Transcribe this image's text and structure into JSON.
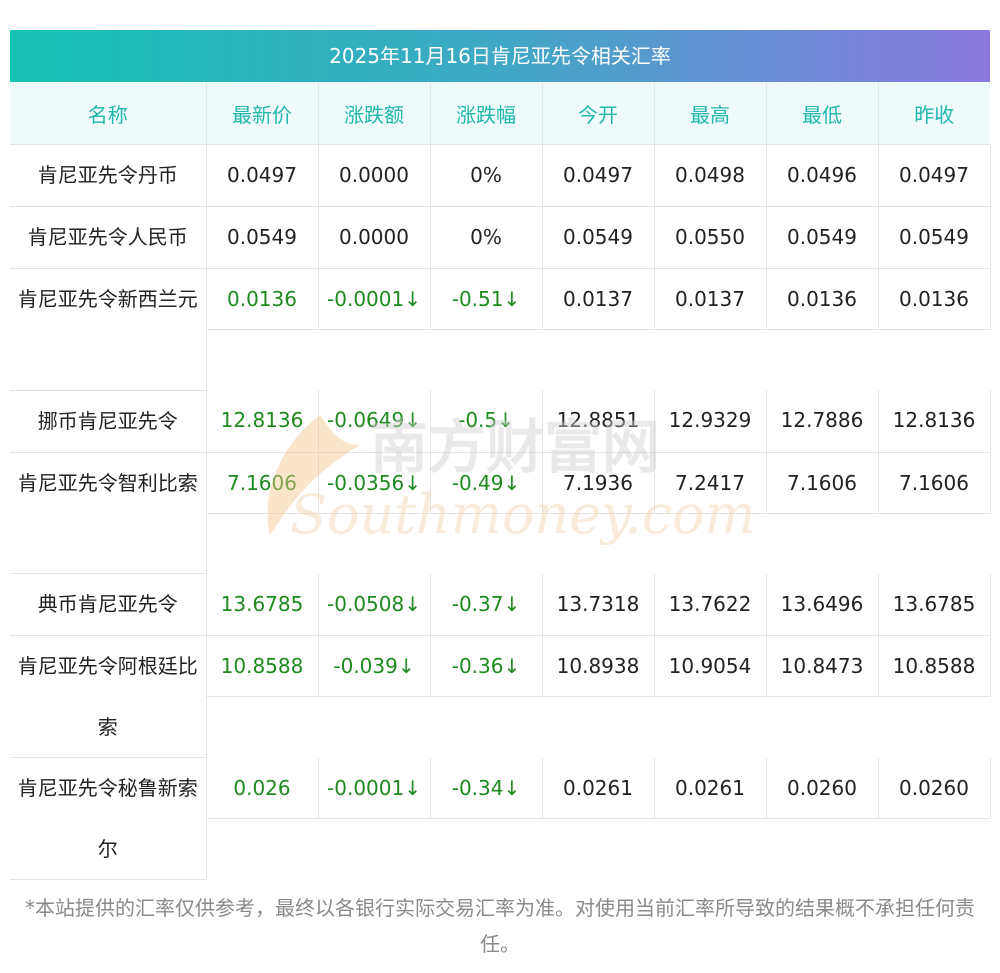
{
  "title": "2025年11月16日肯尼亚先令相关汇率",
  "headers": [
    "名称",
    "最新价",
    "涨跌额",
    "涨跌幅",
    "今开",
    "最高",
    "最低",
    "昨收"
  ],
  "rows": [
    {
      "name": "肯尼亚先令丹币",
      "name_lines": 1,
      "latest": "0.0497",
      "change": "0.0000",
      "pct": "0%",
      "open": "0.0497",
      "high": "0.0498",
      "low": "0.0496",
      "prev": "0.0497",
      "down": false
    },
    {
      "name": "肯尼亚先令人民币",
      "name_lines": 1,
      "latest": "0.0549",
      "change": "0.0000",
      "pct": "0%",
      "open": "0.0549",
      "high": "0.0550",
      "low": "0.0549",
      "prev": "0.0549",
      "down": false
    },
    {
      "name": "肯尼亚先令新西兰元",
      "name_lines": 2,
      "latest": "0.0136",
      "change": "-0.0001↓",
      "pct": "-0.51↓",
      "open": "0.0137",
      "high": "0.0137",
      "low": "0.0136",
      "prev": "0.0136",
      "down": true
    },
    {
      "name": "挪币肯尼亚先令",
      "name_lines": 1,
      "latest": "12.8136",
      "change": "-0.0649↓",
      "pct": "-0.5↓",
      "open": "12.8851",
      "high": "12.9329",
      "low": "12.7886",
      "prev": "12.8136",
      "down": true
    },
    {
      "name": "肯尼亚先令智利比索",
      "name_lines": 2,
      "latest": "7.1606",
      "change": "-0.0356↓",
      "pct": "-0.49↓",
      "open": "7.1936",
      "high": "7.2417",
      "low": "7.1606",
      "prev": "7.1606",
      "down": true
    },
    {
      "name": "典币肯尼亚先令",
      "name_lines": 1,
      "latest": "13.6785",
      "change": "-0.0508↓",
      "pct": "-0.37↓",
      "open": "13.7318",
      "high": "13.7622",
      "low": "13.6496",
      "prev": "13.6785",
      "down": true
    },
    {
      "name": "肯尼亚先令阿根廷比索",
      "name_lines": 2,
      "latest": "10.8588",
      "change": "-0.039↓",
      "pct": "-0.36↓",
      "open": "10.8938",
      "high": "10.9054",
      "low": "10.8473",
      "prev": "10.8588",
      "down": true
    },
    {
      "name": "肯尼亚先令秘鲁新索尔",
      "name_lines": 2,
      "latest": "0.026",
      "change": "-0.0001↓",
      "pct": "-0.34↓",
      "open": "0.0261",
      "high": "0.0261",
      "low": "0.0260",
      "prev": "0.0260",
      "down": true
    }
  ],
  "footnote": "*本站提供的汇率仅供参考，最终以各银行实际交易汇率为准。对使用当前汇率所导致的结果概不承担任何责任。",
  "watermark": {
    "cn": "南方财富网",
    "en": "Southmoney.com"
  },
  "colors": {
    "header_text": "#22b6ad",
    "header_bg": "#effbfb",
    "down": "#1f8a1f",
    "title_start": "#16c2b3",
    "title_end": "#8c78e0"
  }
}
